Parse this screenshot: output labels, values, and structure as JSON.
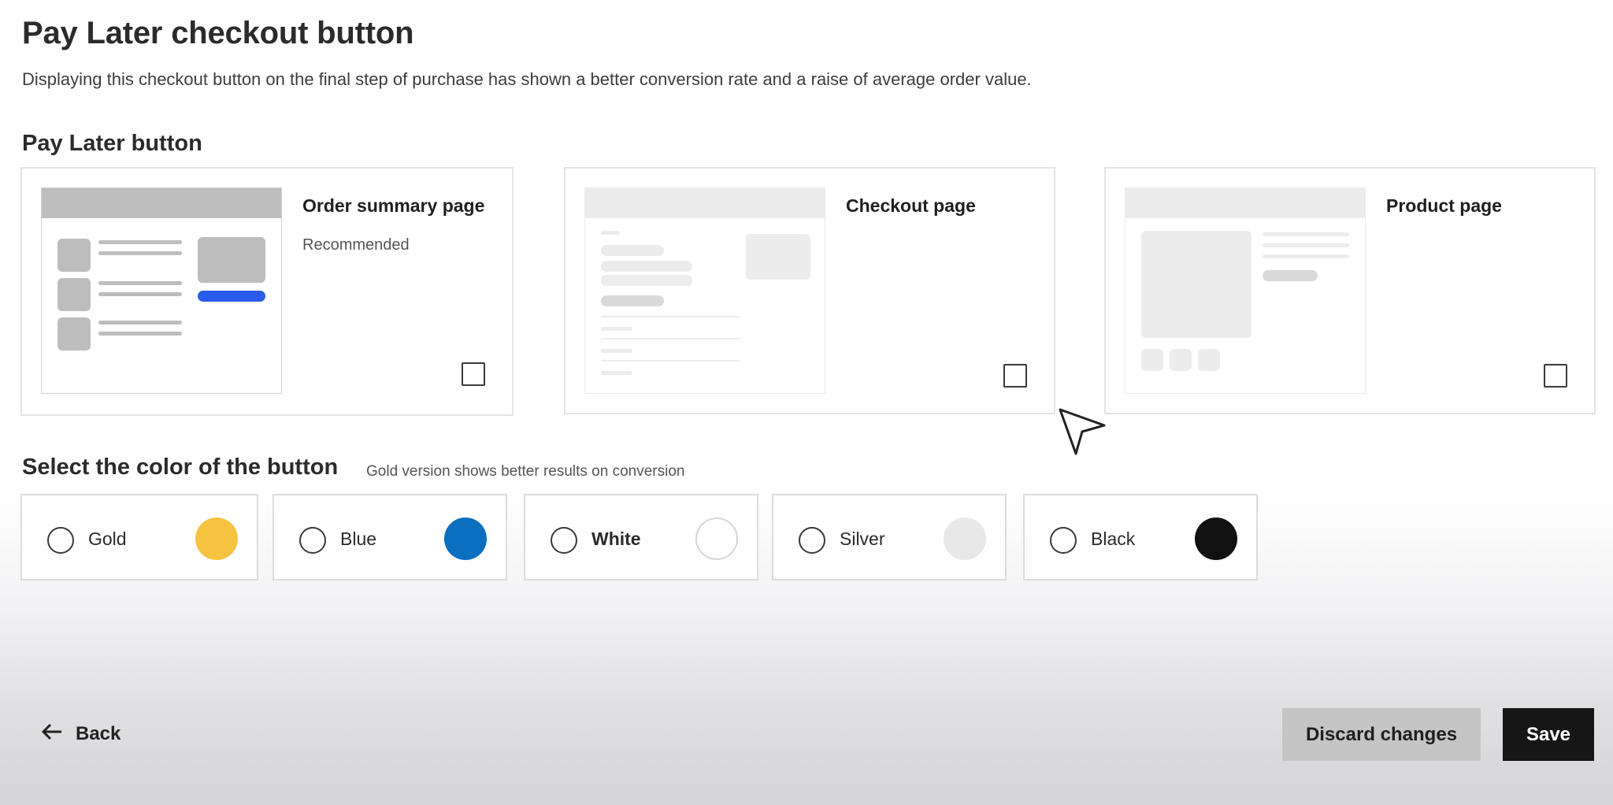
{
  "header": {
    "title": "Pay Later checkout button",
    "description": "Displaying this checkout button on the final step of purchase has shown a better conversion rate and a raise of average order value."
  },
  "placement": {
    "section_title": "Pay Later button",
    "cards": [
      {
        "title": "Order summary page",
        "subtitle": "Recommended",
        "checked": false
      },
      {
        "title": "Checkout page",
        "subtitle": "",
        "checked": false
      },
      {
        "title": "Product page",
        "subtitle": "",
        "checked": false
      }
    ]
  },
  "color": {
    "section_title": "Select the color of the button",
    "hint": "Gold version shows better results on conversion",
    "options": [
      {
        "label": "Gold",
        "swatch": "#f6c340",
        "selected": false
      },
      {
        "label": "Blue",
        "swatch": "#0a6fbf",
        "selected": false
      },
      {
        "label": "White",
        "swatch": "#ffffff",
        "selected": false
      },
      {
        "label": "Silver",
        "swatch": "#e8e8e8",
        "selected": false
      },
      {
        "label": "Black",
        "swatch": "#111111",
        "selected": false
      }
    ]
  },
  "footer": {
    "back_label": "Back",
    "discard_label": "Discard changes",
    "save_label": "Save"
  },
  "colors": {
    "accent_blue": "#2a5bea",
    "primary_button": "#161616",
    "secondary_button": "#c5c5c5"
  }
}
